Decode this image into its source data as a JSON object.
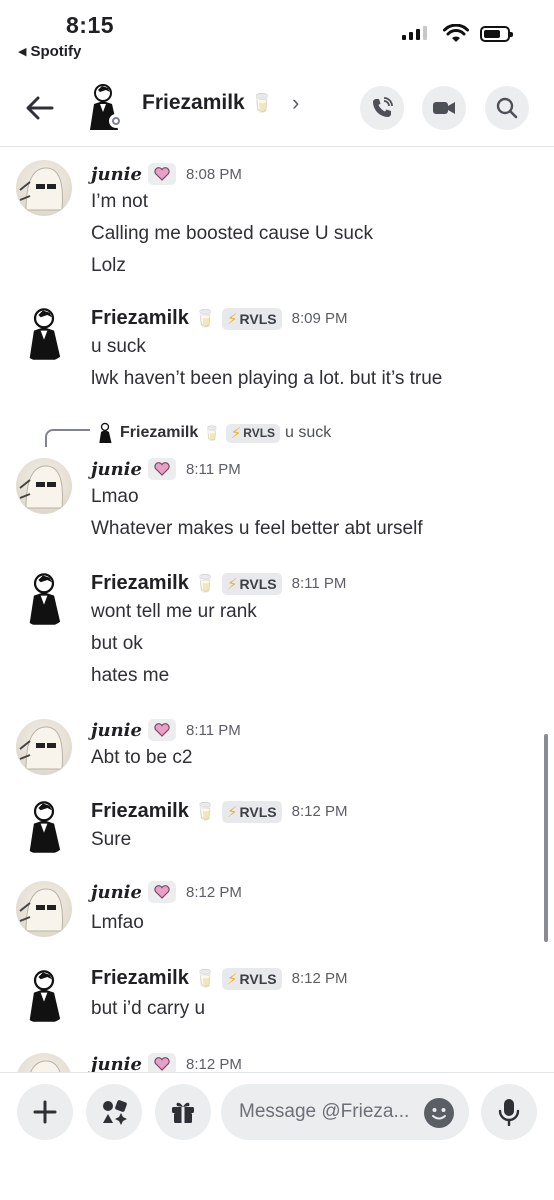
{
  "status_bar": {
    "time": "8:15",
    "back_app": "Spotify",
    "back_arrow": "◀"
  },
  "header": {
    "title": "Friezamilk",
    "title_emoji": "🥛"
  },
  "messages": [
    {
      "author": "junie",
      "time": "8:08 PM",
      "lines": [
        "I’m not",
        "Calling me boosted cause U suck",
        "Lolz"
      ]
    },
    {
      "author": "Friezamilk",
      "emoji": "🥛",
      "tag": "RVLS",
      "time": "8:09 PM",
      "lines": [
        "u suck",
        "lwk haven’t been playing a lot. but it’s true"
      ]
    },
    {
      "reply": {
        "author": "Friezamilk",
        "emoji": "🥛",
        "tag": "RVLS",
        "text": "u suck"
      },
      "author": "junie",
      "time": "8:11 PM",
      "lines": [
        "Lmao",
        "Whatever makes u feel better abt urself"
      ]
    },
    {
      "author": "Friezamilk",
      "emoji": "🥛",
      "tag": "RVLS",
      "time": "8:11 PM",
      "lines": [
        "wont tell me ur rank",
        "but ok",
        "hates me"
      ]
    },
    {
      "author": "junie",
      "time": "8:11 PM",
      "lines": [
        "Abt to be c2"
      ]
    },
    {
      "author": "Friezamilk",
      "emoji": "🥛",
      "tag": "RVLS",
      "time": "8:12 PM",
      "lines": [
        "Sure"
      ]
    },
    {
      "author": "junie",
      "time": "8:12 PM",
      "lines": [
        "Lmfao"
      ]
    },
    {
      "author": "Friezamilk",
      "emoji": "🥛",
      "tag": "RVLS",
      "time": "8:12 PM",
      "lines": [
        "but i’d carry u"
      ]
    },
    {
      "author": "junie",
      "time": "8:12 PM",
      "lines": []
    }
  ],
  "composer": {
    "placeholder": "Message @Frieza..."
  },
  "icons": {
    "back": "arrow-left-icon",
    "call": "phone-icon",
    "video": "video-camera-icon",
    "search": "search-icon",
    "add": "plus-icon",
    "apps": "apps-icon",
    "gift": "gift-icon",
    "emoji": "emoji-icon",
    "mic": "microphone-icon"
  },
  "colors": {
    "accent_bolt": "#f0b232",
    "heart": "#e8a0c8",
    "text": "#1f2023",
    "muted": "#5c5e66"
  }
}
